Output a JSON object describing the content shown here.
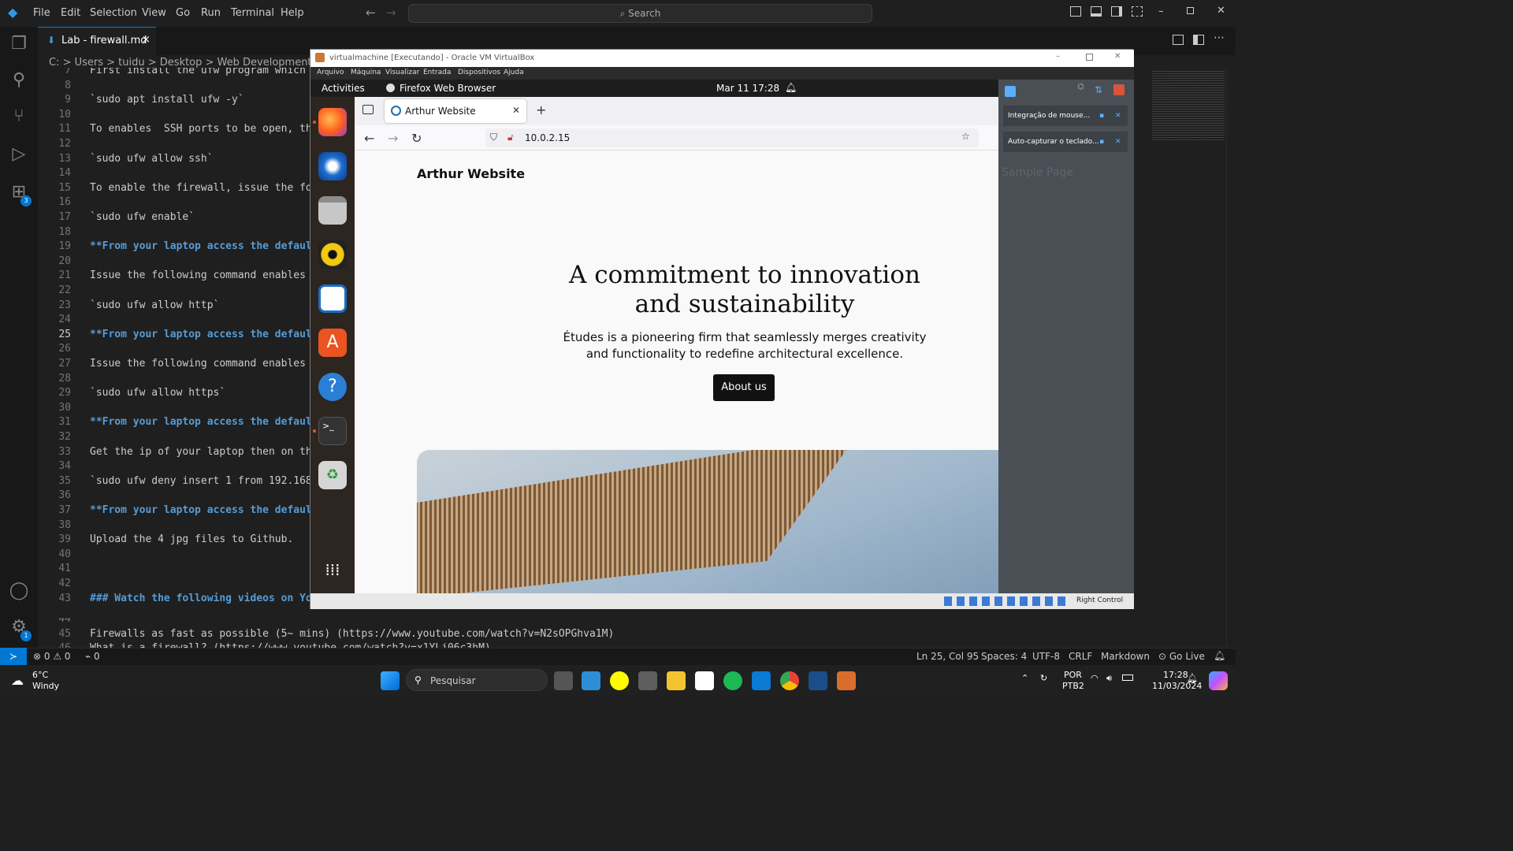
{
  "titlebar": {
    "menu": [
      "File",
      "Edit",
      "Selection",
      "View",
      "Go",
      "Run",
      "Terminal",
      "Help"
    ],
    "search_placeholder": "Search"
  },
  "activity": {
    "extensions_badge": "3",
    "settings_badge": "1"
  },
  "tab": {
    "label": "Lab - firewall.md",
    "close": "×"
  },
  "breadcrumb": "C: > Users > tuidu > Desktop > Web Development & Inter",
  "editor": {
    "lines": [
      {
        "n": "7",
        "t": "First install the ufw program which u",
        "cls": ""
      },
      {
        "n": "8",
        "t": "",
        "cls": ""
      },
      {
        "n": "9",
        "t": "`sudo apt install ufw -y`",
        "cls": ""
      },
      {
        "n": "10",
        "t": "",
        "cls": ""
      },
      {
        "n": "11",
        "t": "To enables  SSH ports to be open, tha",
        "cls": ""
      },
      {
        "n": "12",
        "t": "",
        "cls": ""
      },
      {
        "n": "13",
        "t": "`sudo ufw allow ssh`",
        "cls": ""
      },
      {
        "n": "14",
        "t": "",
        "cls": ""
      },
      {
        "n": "15",
        "t": "To enable the firewall, issue the fol",
        "cls": ""
      },
      {
        "n": "16",
        "t": "",
        "cls": ""
      },
      {
        "n": "17",
        "t": "`sudo ufw enable`",
        "cls": ""
      },
      {
        "n": "18",
        "t": "",
        "cls": ""
      },
      {
        "n": "19",
        "t": "**From your laptop access the default",
        "cls": "bold"
      },
      {
        "n": "20",
        "t": "",
        "cls": ""
      },
      {
        "n": "21",
        "t": "Issue the following command enables p",
        "cls": ""
      },
      {
        "n": "22",
        "t": "",
        "cls": ""
      },
      {
        "n": "23",
        "t": "`sudo ufw allow http`",
        "cls": ""
      },
      {
        "n": "24",
        "t": "",
        "cls": ""
      },
      {
        "n": "25",
        "t": "**From your laptop access the default",
        "cls": "bold"
      },
      {
        "n": "26",
        "t": "",
        "cls": ""
      },
      {
        "n": "27",
        "t": "Issue the following command enables p",
        "cls": ""
      },
      {
        "n": "28",
        "t": "",
        "cls": ""
      },
      {
        "n": "29",
        "t": "`sudo ufw allow https`",
        "cls": ""
      },
      {
        "n": "30",
        "t": "",
        "cls": ""
      },
      {
        "n": "31",
        "t": "**From your laptop access the default",
        "cls": "bold"
      },
      {
        "n": "32",
        "t": "",
        "cls": ""
      },
      {
        "n": "33",
        "t": "Get the ip of your laptop then on the",
        "cls": ""
      },
      {
        "n": "34",
        "t": "",
        "cls": ""
      },
      {
        "n": "35",
        "t": "`sudo ufw deny insert 1 from 192.168.",
        "cls": ""
      },
      {
        "n": "36",
        "t": "",
        "cls": ""
      },
      {
        "n": "37",
        "t": "**From your laptop access the default",
        "cls": "bold"
      },
      {
        "n": "38",
        "t": "",
        "cls": ""
      },
      {
        "n": "39",
        "t": "Upload the 4 jpg files to Github.",
        "cls": ""
      },
      {
        "n": "40",
        "t": "",
        "cls": ""
      },
      {
        "n": "41",
        "t": "",
        "cls": ""
      },
      {
        "n": "42",
        "t": "",
        "cls": ""
      },
      {
        "n": "43",
        "t": "### Watch the following videos on You",
        "cls": "bold"
      }
    ],
    "tail": [
      {
        "n": "44",
        "t": ""
      },
      {
        "n": "45",
        "t": "Firewalls as fast as possible (5~ mins) (https://www.youtube.com/watch?v=N2sOPGhva1M)"
      },
      {
        "n": "46",
        "t": "What is a firewall? (https://www.youtube.com/watch?v=x1YLj06c3hM)"
      }
    ]
  },
  "statusbar": {
    "errors": "0",
    "warnings": "0",
    "ports": "0",
    "position": "Ln 25, Col 95",
    "spaces": "Spaces: 4",
    "encoding": "UTF-8",
    "eol": "CRLF",
    "language": "Markdown",
    "golive": "Go Live"
  },
  "vbox": {
    "title": "virtualmachine [Executando] - Oracle VM VirtualBox",
    "menu": [
      "Arquivo",
      "Máquina",
      "Visualizar",
      "Entrada",
      "Dispositivos",
      "Ajuda"
    ],
    "hostkey": "Right Control",
    "panel_items": [
      "Integração de mouse...",
      "Auto-capturar o teclado..."
    ]
  },
  "ubuntu": {
    "activities": "Activities",
    "app": "Firefox Web Browser",
    "clock": "Mar 11  17:28"
  },
  "firefox": {
    "tab_title": "Arthur Website",
    "url": "10.0.2.15",
    "site_title": "Arthur Website",
    "nav_link": "Sample Page",
    "headline": "A commitment to innovation and sustainability",
    "subtext": "Études is a pioneering firm that seamlessly merges creativity and functionality to redefine architectural excellence.",
    "button": "About us"
  },
  "taskbar": {
    "weather_temp": "6°C",
    "weather_desc": "Windy",
    "search": "Pesquisar",
    "lang1": "POR",
    "lang2": "PTB2",
    "time": "17:28",
    "date": "11/03/2024"
  }
}
